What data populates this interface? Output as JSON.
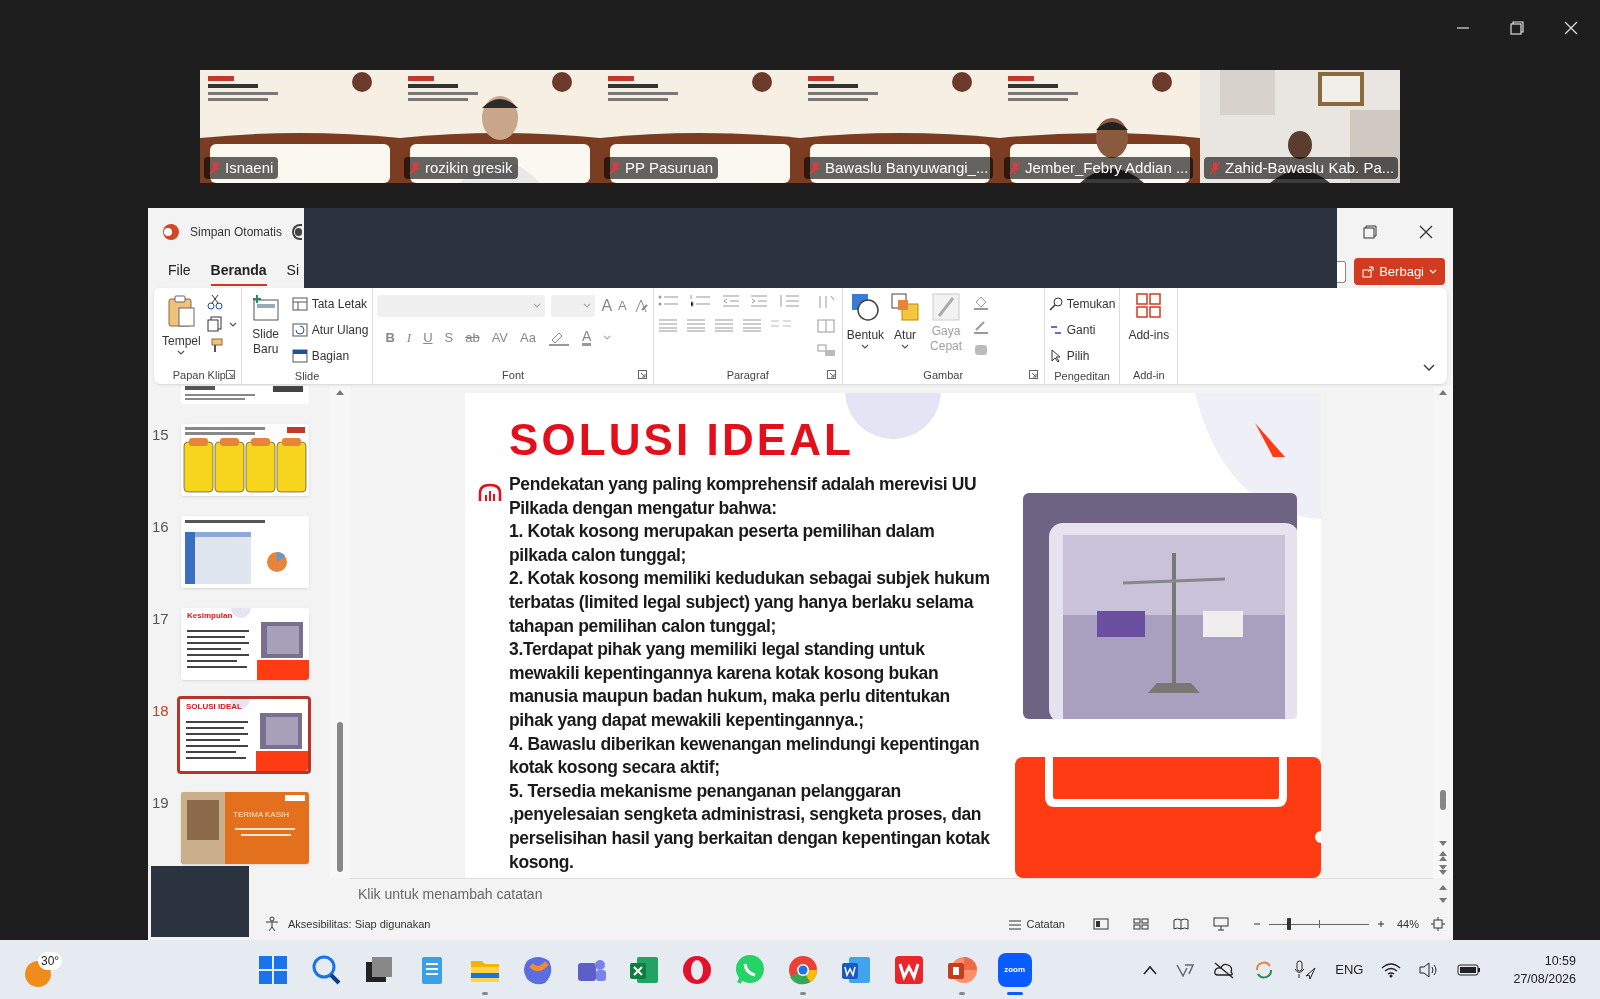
{
  "participants": [
    {
      "name": "Isnaeni",
      "muted": true
    },
    {
      "name": "rozikin gresik",
      "muted": true
    },
    {
      "name": "PP Pasuruan",
      "muted": true
    },
    {
      "name": "Bawaslu Banyuwangi_...",
      "muted": true
    },
    {
      "name": "Jember_Febry Addian ...",
      "muted": true
    },
    {
      "name": "Zahid-Bawaslu Kab. Pa...",
      "muted": true
    }
  ],
  "app": {
    "autosave_label": "Simpan Otomatis",
    "tabs": [
      {
        "label": "File",
        "selected": false
      },
      {
        "label": "Beranda",
        "selected": true
      },
      {
        "label": "Si",
        "selected": false
      }
    ],
    "autosave_on": false,
    "share_button": "Berbagi"
  },
  "ribbon": {
    "clipboard": {
      "paste": "Tempel",
      "label": "Papan Klip"
    },
    "slides": {
      "new_slide": "Slide Baru",
      "layout": "Tata Letak",
      "reset": "Atur Ulang",
      "section": "Bagian",
      "label": "Slide"
    },
    "font": {
      "grow": "A",
      "shrink": "A",
      "format_buttons": [
        "B",
        "I",
        "U",
        "S",
        "ab",
        "AV",
        "Aa"
      ],
      "font_color": "A",
      "label": "Font"
    },
    "paragraph": {
      "label": "Paragraf"
    },
    "drawing": {
      "shapes": "Bentuk",
      "arrange": "Atur",
      "quick_styles": "Gaya Cepat",
      "quick_styles_disabled": true,
      "label": "Gambar"
    },
    "editing": {
      "find": "Temukan",
      "replace": "Ganti",
      "select": "Pilih",
      "label": "Pengeditan"
    },
    "addins": {
      "button": "Add-ins",
      "label": "Add-in"
    }
  },
  "thumbnails": [
    {
      "number": "15",
      "kind": "cards",
      "selected": false
    },
    {
      "number": "16",
      "kind": "table",
      "selected": false
    },
    {
      "number": "17",
      "title": "Kesimpulan",
      "selected": false
    },
    {
      "number": "18",
      "title": "SOLUSI IDEAL",
      "selected": true
    },
    {
      "number": "19",
      "kind": "closing",
      "title": "TERIMA KASIH",
      "selected": false
    }
  ],
  "slide": {
    "title": "SOLUSI IDEAL",
    "paragraphs": [
      "Pendekatan yang paling komprehensif adalah merevisi UU Pilkada dengan mengatur bahwa:",
      "1. Kotak kosong merupakan peserta pemilihan dalam pilkada calon tunggal;",
      "2. Kotak kosong memiliki kedudukan sebagai subjek hukum terbatas (limited legal subject) yang hanya berlaku selama tahapan pemilihan calon tunggal;",
      "3.Terdapat pihak yang memiliki legal standing untuk mewakili kepentingannya karena kotak kosong bukan manusia maupun badan hukum, maka perlu ditentukan pihak yang dapat mewakili kepentingannya.;",
      "4. Bawaslu diberikan kewenangan melindungi kepentingan kotak kosong secara aktif;",
      "5. Tersedia mekanisme penanganan pelanggaran ,penyelesaian sengketa administrasi, sengketa proses, dan perselisihan hasil yang berkaitan dengan kepentingan kotak kosong."
    ]
  },
  "notes_placeholder": "Klik untuk menambah catatan",
  "status_bar": {
    "accessibility": "Aksesibilitas: Siap digunakan",
    "notes_button": "Catatan",
    "zoom": "44%",
    "zoom_slider": {
      "level": 0.2
    }
  },
  "taskbar": {
    "weather": "30°",
    "apps": [
      {
        "kind": "start",
        "running": false
      },
      {
        "kind": "search",
        "running": false
      },
      {
        "kind": "taskview",
        "running": false
      },
      {
        "kind": "notepad",
        "running": false
      },
      {
        "kind": "folder",
        "running": true
      },
      {
        "kind": "assistant",
        "running": false
      },
      {
        "kind": "teams",
        "running": false
      },
      {
        "kind": "sheet",
        "running": false
      },
      {
        "kind": "opera",
        "running": false
      },
      {
        "kind": "chat",
        "running": false
      },
      {
        "kind": "chrome",
        "running": true
      },
      {
        "kind": "word",
        "running": false
      },
      {
        "kind": "wps",
        "running": false
      },
      {
        "kind": "slides",
        "running": true
      },
      {
        "kind": "zoom",
        "label": "zoom",
        "running": true
      }
    ],
    "language": "ENG",
    "time": "10:59",
    "date": "27/08/2026"
  }
}
